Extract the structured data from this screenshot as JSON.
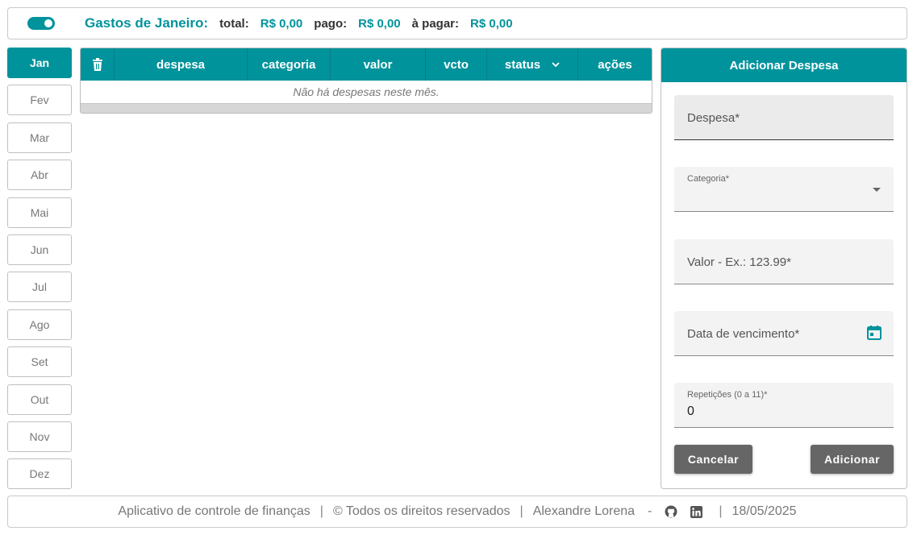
{
  "header": {
    "title": "Gastos de Janeiro:",
    "total_label": "total:",
    "total_value": "R$ 0,00",
    "paid_label": "pago:",
    "paid_value": "R$ 0,00",
    "due_label": "à pagar:",
    "due_value": "R$ 0,00",
    "toggle_on": true
  },
  "months": [
    "Jan",
    "Fev",
    "Mar",
    "Abr",
    "Mai",
    "Jun",
    "Jul",
    "Ago",
    "Set",
    "Out",
    "Nov",
    "Dez"
  ],
  "active_month": "Jan",
  "table": {
    "columns": [
      "despesa",
      "categoria",
      "valor",
      "vcto",
      "status",
      "ações"
    ],
    "empty_message": "Não há despesas neste mês."
  },
  "form": {
    "title": "Adicionar Despesa",
    "expense_placeholder": "Despesa*",
    "category_label": "Categoria*",
    "value_placeholder": "Valor - Ex.: 123.99*",
    "due_date_placeholder": "Data de vencimento*",
    "repetitions_label": "Repetições (0 a 11)*",
    "repetitions_value": "0",
    "cancel_label": "Cancelar",
    "add_label": "Adicionar"
  },
  "footer": {
    "app_text": "Aplicativo de controle de finanças",
    "rights": "© Todos os direitos reservados",
    "author": "Alexandre Lorena",
    "dash": "-",
    "date": "18/05/2025"
  },
  "colors": {
    "accent": "#00939c",
    "button": "#666666"
  }
}
